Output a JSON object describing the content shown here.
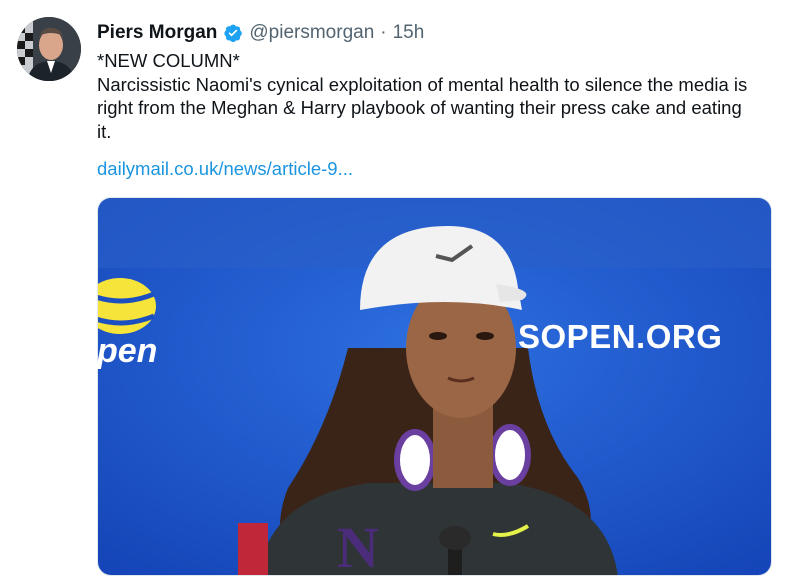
{
  "tweet": {
    "author_name": "Piers Morgan",
    "handle": "@piersmorgan",
    "separator": "·",
    "time": "15h",
    "verified": true,
    "lines": [
      "*NEW COLUMN*",
      "Narcissistic Naomi's cynical exploitation of mental health to silence the media is right from the Meghan & Harry playbook of wanting their press cake and eating it."
    ],
    "link_text": "dailymail.co.uk/news/article-9..."
  },
  "media": {
    "brand_right": "SOPEN.ORG",
    "brand_left": "pen",
    "jersey_letter": "N"
  },
  "colors": {
    "link": "#1b95e0",
    "verified": "#1da1f2",
    "backdrop": "#1f5ad1"
  },
  "icons": {
    "verified": "verified-badge-icon",
    "avatar": "avatar-photo"
  }
}
